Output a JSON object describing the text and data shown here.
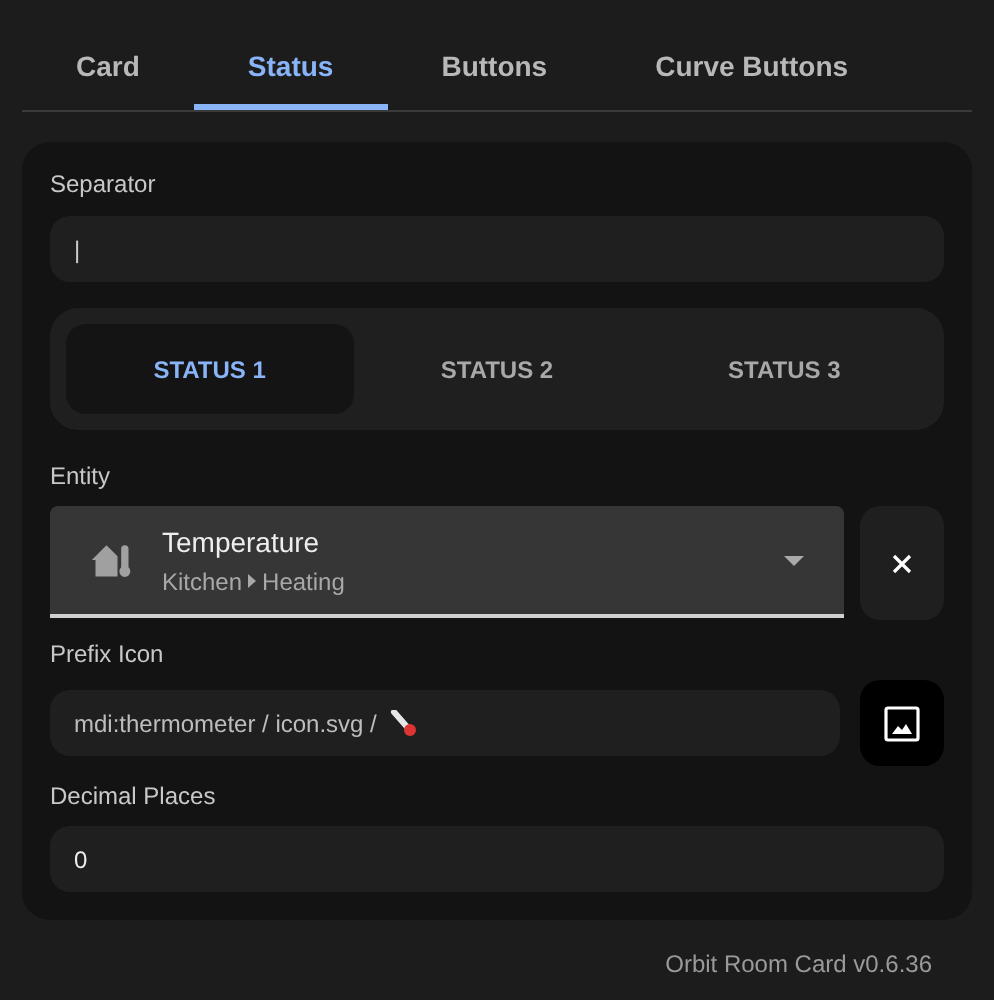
{
  "tabs": [
    {
      "label": "Card",
      "selected": false
    },
    {
      "label": "Status",
      "selected": true
    },
    {
      "label": "Buttons",
      "selected": false
    },
    {
      "label": "Curve Buttons",
      "selected": false
    }
  ],
  "separator": {
    "label": "Separator",
    "value": "|"
  },
  "status_tabs": [
    {
      "label": "STATUS 1",
      "selected": true
    },
    {
      "label": "STATUS 2",
      "selected": false
    },
    {
      "label": "STATUS 3",
      "selected": false
    }
  ],
  "entity": {
    "label": "Entity",
    "name": "Temperature",
    "area": "Kitchen",
    "device": "Heating"
  },
  "prefix_icon": {
    "label": "Prefix Icon",
    "placeholder": "mdi:thermometer / icon.svg /"
  },
  "decimal_places": {
    "label": "Decimal Places",
    "value": "0"
  },
  "footer": "Orbit Room Card v0.6.36"
}
